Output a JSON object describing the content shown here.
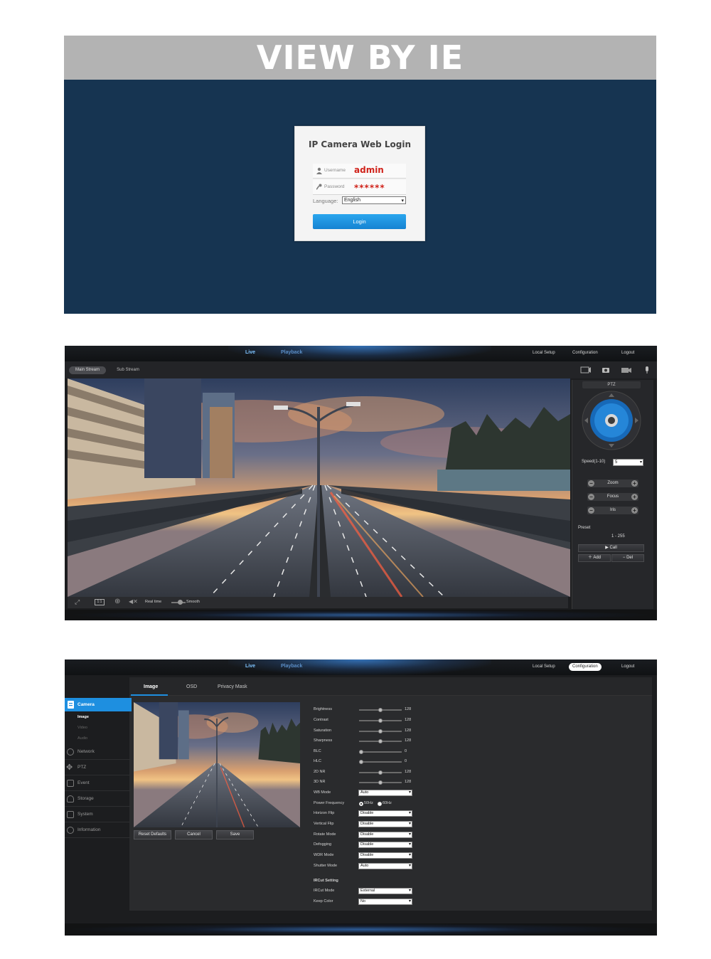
{
  "section1": {
    "banner": "VIEW BY IE",
    "login": {
      "title": "IP Camera Web Login",
      "username_label": "Username",
      "username_value": "admin",
      "password_label": "Password",
      "password_value": "******",
      "language_label": "Language:",
      "language_value": "English",
      "login_button": "Login"
    }
  },
  "nav": {
    "live": "Live",
    "playback": "Playback",
    "local_setup": "Local Setup",
    "configuration": "Configuration",
    "logout": "Logout"
  },
  "section2": {
    "main_stream": "Main Stream",
    "sub_stream": "Sub Stream",
    "real_time": "Real time",
    "smooth": "Smooth",
    "ptz": {
      "title": "PTZ",
      "speed_label": "Speed(1-10)",
      "speed_value": "5",
      "zoom": "Zoom",
      "focus": "Focus",
      "iris": "Iris",
      "preset_label": "Preset",
      "preset_range": "1 - 255",
      "call": "Call",
      "add": "Add",
      "del": "Del"
    }
  },
  "section3": {
    "tabs": [
      "Image",
      "OSD",
      "Privacy Mask"
    ],
    "sidebar": {
      "camera": "Camera",
      "camera_sub": [
        "Image",
        "Video",
        "Audio"
      ],
      "network": "Network",
      "ptz": "PTZ",
      "event": "Event",
      "storage": "Storage",
      "system": "System",
      "information": "Information"
    },
    "buttons": {
      "reset": "Reset Defaults",
      "cancel": "Cancel",
      "save": "Save"
    },
    "sliders": [
      {
        "label": "Brightness",
        "value": 128
      },
      {
        "label": "Contrast",
        "value": 128
      },
      {
        "label": "Saturation",
        "value": 128
      },
      {
        "label": "Sharpness",
        "value": 128
      },
      {
        "label": "BLC",
        "value": 0
      },
      {
        "label": "HLC",
        "value": 0
      },
      {
        "label": "2D NR",
        "value": 128
      },
      {
        "label": "3D NR",
        "value": 128
      }
    ],
    "wb_mode": {
      "label": "WB Mode",
      "value": "Auto"
    },
    "power_frequency": {
      "label": "Power Frequency",
      "opt1": "50Hz",
      "opt2": "60Hz"
    },
    "selects": [
      {
        "label": "Horizon Flip",
        "value": "Disable"
      },
      {
        "label": "Vertical Flip",
        "value": "Disable"
      },
      {
        "label": "Rotate Mode",
        "value": "Disable"
      },
      {
        "label": "Defogging",
        "value": "Disable"
      },
      {
        "label": "WDR Mode",
        "value": "Disable"
      },
      {
        "label": "Shutter Mode",
        "value": "Auto"
      }
    ],
    "ircut_heading": "IRCut Setting",
    "ircut_selects": [
      {
        "label": "IRCut Mode",
        "value": "External"
      },
      {
        "label": "Keep Color",
        "value": "No"
      }
    ]
  },
  "colors": {
    "login_bg": "#163451",
    "banner_bg": "#b3b3b3",
    "accent_blue": "#1e8fe0",
    "password_red": "#d0231b"
  }
}
